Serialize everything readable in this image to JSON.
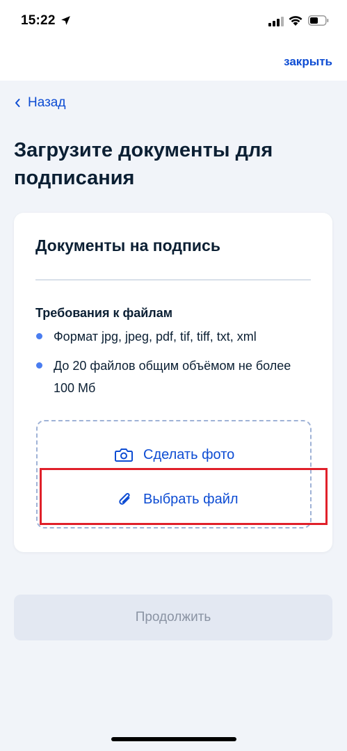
{
  "status_bar": {
    "time": "15:22",
    "icons": [
      "location-arrow-icon",
      "cellular-signal-icon",
      "wifi-icon",
      "battery-icon"
    ]
  },
  "header": {
    "close_label": "закрыть"
  },
  "nav": {
    "back_label": "Назад",
    "back_icon": "chevron-left-icon"
  },
  "page": {
    "title": "Загрузите документы для подписания"
  },
  "card": {
    "title": "Документы на подпись",
    "requirements_title": "Требования к файлам",
    "requirements": [
      "Формат jpg, jpeg, pdf, tif, tiff, txt, xml",
      "До 20 файлов общим объёмом не более 100 Мб"
    ],
    "actions": {
      "take_photo": "Сделать фото",
      "take_photo_icon": "camera-icon",
      "choose_file": "Выбрать файл",
      "choose_file_icon": "paperclip-icon"
    }
  },
  "footer": {
    "continue_label": "Продолжить"
  },
  "colors": {
    "accent": "#0d4cd3",
    "bullet": "#4a7df0",
    "highlight": "#e0202a",
    "page_bg": "#f1f4f9",
    "button_disabled_bg": "#e3e8f2",
    "button_disabled_text": "#8a93a3"
  }
}
